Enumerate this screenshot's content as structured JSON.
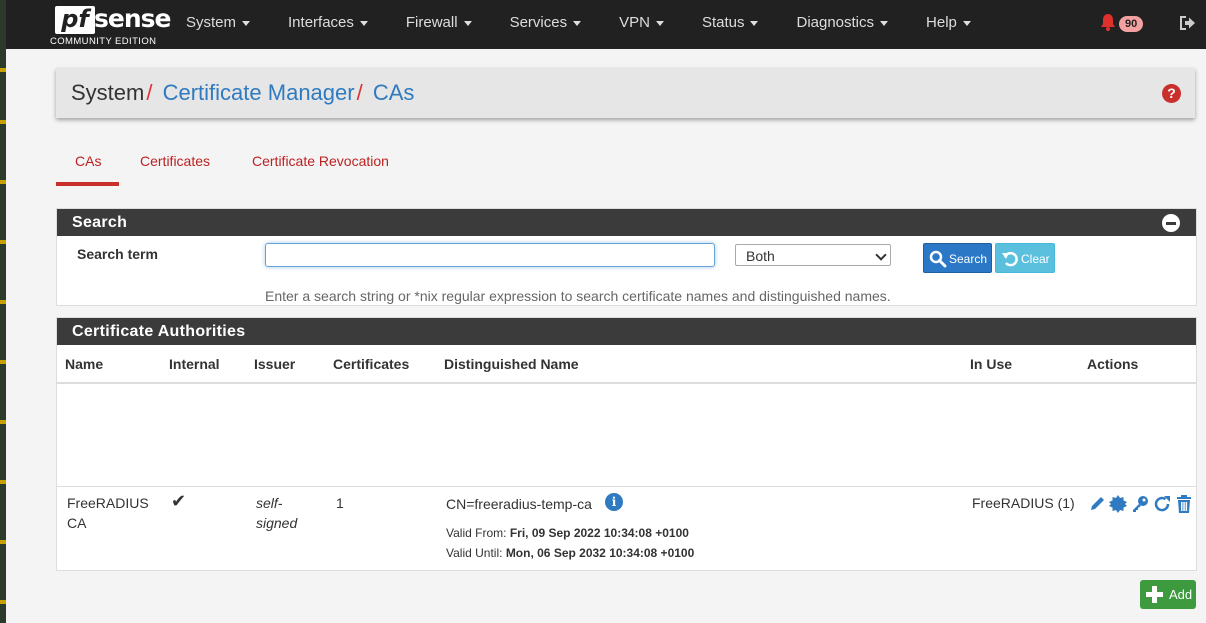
{
  "brand": {
    "name_pf": "pf",
    "name_sense": "sense",
    "edition": "COMMUNITY EDITION"
  },
  "nav": {
    "items": [
      {
        "label": "System"
      },
      {
        "label": "Interfaces"
      },
      {
        "label": "Firewall"
      },
      {
        "label": "Services"
      },
      {
        "label": "VPN"
      },
      {
        "label": "Status"
      },
      {
        "label": "Diagnostics"
      },
      {
        "label": "Help"
      }
    ],
    "notification_count": "90",
    "icons": [
      "bell-icon",
      "logout-icon"
    ]
  },
  "breadcrumb": {
    "root": "System",
    "sep": "/",
    "section": "Certificate Manager",
    "page": "CAs",
    "help": "?"
  },
  "tabs": [
    {
      "label": "CAs",
      "active": true
    },
    {
      "label": "Certificates",
      "active": false
    },
    {
      "label": "Certificate Revocation",
      "active": false
    }
  ],
  "search": {
    "title": "Search",
    "term_label": "Search term",
    "term_value": "",
    "scope_selected": "Both",
    "search_label": "Search",
    "clear_label": "Clear",
    "hint": "Enter a search string or *nix regular expression to search certificate names and distinguished names."
  },
  "ca_panel": {
    "title": "Certificate Authorities",
    "columns": [
      "Name",
      "Internal",
      "Issuer",
      "Certificates",
      "Distinguished Name",
      "In Use",
      "Actions"
    ],
    "rows": [
      {
        "name_line1": "FreeRADIUS",
        "name_line2": "CA",
        "internal": "✔",
        "issuer_line1": "self-",
        "issuer_line2": "signed",
        "certificates": "1",
        "dn": "CN=freeradius-temp-ca",
        "valid_from_label": "Valid From:",
        "valid_from": "Fri, 09 Sep 2022 10:34:08 +0100",
        "valid_until_label": "Valid Until:",
        "valid_until": "Mon, 06 Sep 2032 10:34:08 +0100",
        "in_use": "FreeRADIUS (1)",
        "actions": [
          "edit-icon",
          "export-certificate-icon",
          "export-key-icon",
          "reissue-icon",
          "delete-icon"
        ]
      }
    ]
  },
  "add_button": {
    "label": "Add"
  },
  "colors": {
    "navbar": "#212121",
    "link": "#2f7ac0",
    "tab_active": "#c9302c",
    "panel_head": "#3b3b3b",
    "add": "#3e9a3e"
  }
}
